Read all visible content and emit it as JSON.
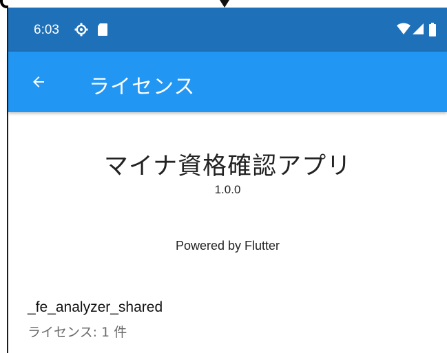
{
  "status_bar": {
    "time": "6:03",
    "icons": [
      "settings-gear-icon",
      "sd-card-icon",
      "wifi-icon",
      "cell-signal-icon",
      "battery-icon"
    ],
    "background": "#1e70b8"
  },
  "app_bar": {
    "back_icon": "arrow-back-icon",
    "title": "ライセンス",
    "background": "#2196f3"
  },
  "about": {
    "app_name": "マイナ資格確認アプリ",
    "version": "1.0.0",
    "powered_by": "Powered by Flutter"
  },
  "licenses": [
    {
      "package": "_fe_analyzer_shared",
      "count_label": "ライセンス: 1 件"
    }
  ]
}
